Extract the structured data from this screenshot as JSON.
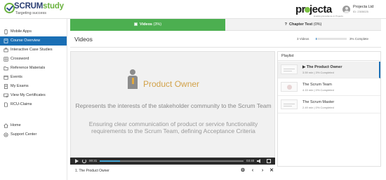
{
  "brand": {
    "logo_text": "SCRUMstudy",
    "logo_word_a": "SCRUM",
    "logo_word_b": "study",
    "tagline": "Targeting success",
    "partner_logo_a": "pr",
    "partner_logo_b": "jecta",
    "partner_tagline": "Enabling Excellence in Projects"
  },
  "user": {
    "name": "Projecta Ltd",
    "id": "ID: 2305025"
  },
  "sidebar": {
    "items": [
      {
        "label": "Mobile Apps",
        "icon": "mobile-icon",
        "active": false
      },
      {
        "label": "Course Overview",
        "icon": "book-icon",
        "active": true
      },
      {
        "label": "Interactive Case Studies",
        "icon": "case-study-icon",
        "active": false
      },
      {
        "label": "Crossword",
        "icon": "crossword-icon",
        "active": false
      },
      {
        "label": "Reference Materials",
        "icon": "folder-icon",
        "active": false
      },
      {
        "label": "Events",
        "icon": "calendar-icon",
        "active": false
      },
      {
        "label": "My Exams",
        "icon": "exam-icon",
        "active": false
      },
      {
        "label": "View My Certificates",
        "icon": "certificate-icon",
        "active": false
      },
      {
        "label": "RCU-Claims",
        "icon": "claims-icon",
        "active": false
      },
      {
        "label": "Home",
        "icon": "home-icon",
        "active": false
      },
      {
        "label": "Support Center",
        "icon": "support-icon",
        "active": false
      }
    ]
  },
  "tabs": {
    "videos": {
      "label": "Videos",
      "percent": "(3%)",
      "icon": "video-icon"
    },
    "chapter_test": {
      "label": "Chapter Test",
      "percent": "(0%)",
      "icon": "question-icon"
    }
  },
  "section": {
    "title": "Videos",
    "count": "3 Videos",
    "progress_label": "3% Complete",
    "progress_fraction": 0.03
  },
  "video": {
    "slide_title": "Product Owner",
    "description_1": "Represents the interests of the stakeholder community to the Scrum Team",
    "description_2": "Ensuring clear communication of product or service functionality requirements to the Scrum Team, defining Acceptance Criteria",
    "time_current": "00:31",
    "time_total": "03:40",
    "played_fraction": 0.14,
    "footer_title": "1. The Product Owner"
  },
  "playlist": {
    "heading": "Playlist",
    "items": [
      {
        "title": "The Product Owner",
        "meta": "3.59 min | 3% Completed",
        "active": true
      },
      {
        "title": "The Scrum Team",
        "meta": "4.15 min | 0% Completed",
        "active": false
      },
      {
        "title": "The Scrum Master",
        "meta": "2.49 min | 0% Completed",
        "active": false
      }
    ]
  },
  "colors": {
    "primary": "#1a6fb5",
    "tab_active": "#4caf50",
    "accent_gold": "#d2a24a",
    "logo_green": "#6bb23f"
  }
}
